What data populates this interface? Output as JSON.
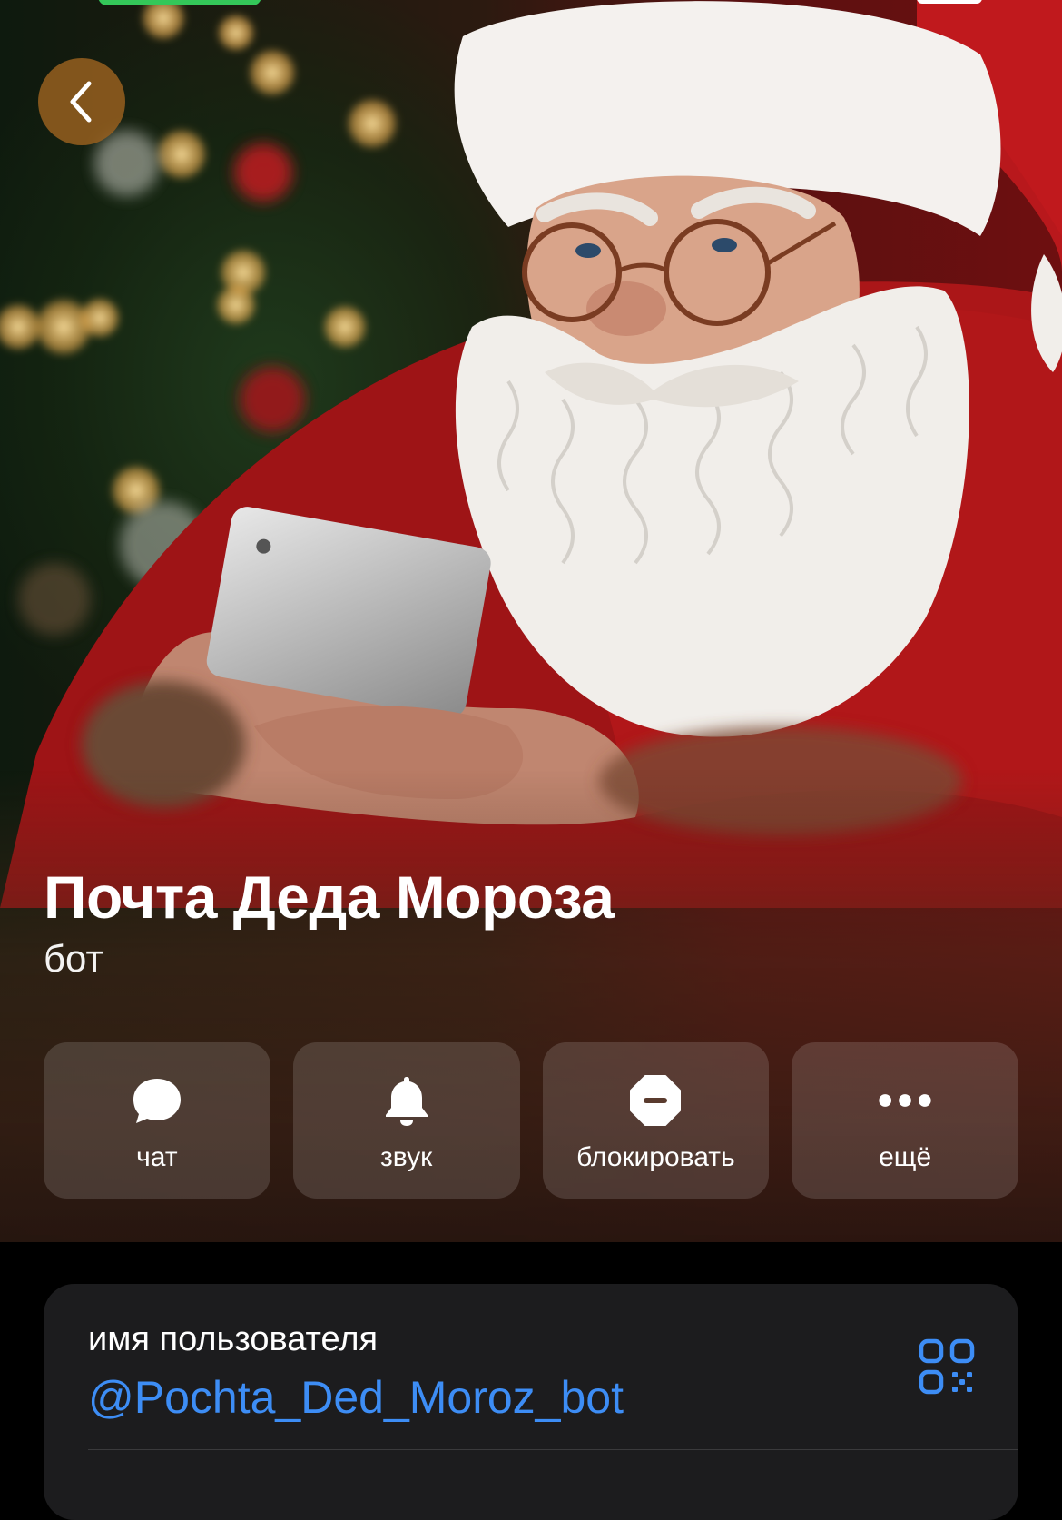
{
  "profile": {
    "name": "Почта Деда Мороза",
    "subtitle": "бот"
  },
  "actions": [
    {
      "label": "чат",
      "icon": "chat-bubble-icon"
    },
    {
      "label": "звук",
      "icon": "bell-icon"
    },
    {
      "label": "блокировать",
      "icon": "block-icon"
    },
    {
      "label": "ещё",
      "icon": "more-dots-icon"
    }
  ],
  "info": {
    "username_label": "имя пользователя",
    "username_value": "@Pochta_Ded_Moroz_bot",
    "qr_icon": "qr-code-icon"
  },
  "colors": {
    "link": "#3d8df5",
    "card_background": "#1c1c1e",
    "back_button": "#965f1e",
    "status_green": "#34c759"
  }
}
